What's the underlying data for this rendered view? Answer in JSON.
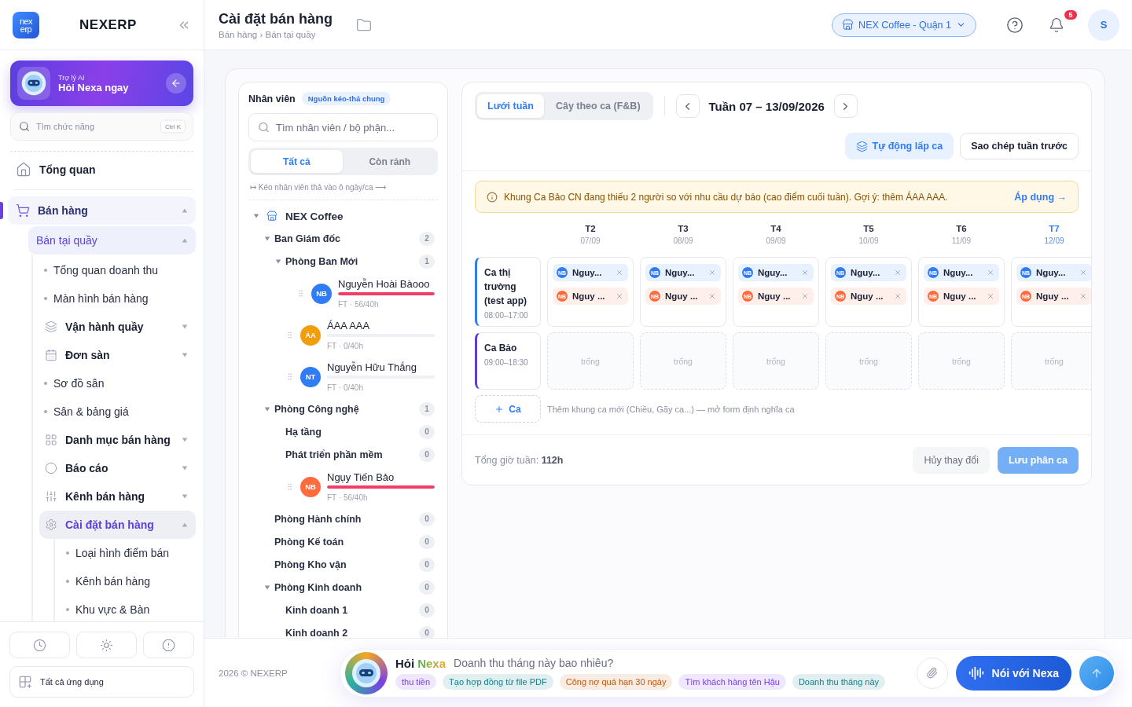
{
  "sidebar": {
    "logo": [
      "nex",
      "erp"
    ],
    "brand": "NEXERP",
    "ai_card": {
      "caption": "Trợ lý AI",
      "title": "Hỏi Nexa ngay"
    },
    "search": {
      "placeholder": "Tìm chức năng",
      "shortcut": "Ctrl K"
    },
    "nav": [
      {
        "label": "Tổng quan",
        "kind": "top",
        "selected": false
      },
      {
        "label": "Bán hàng",
        "kind": "section",
        "selected": true,
        "expanded": true,
        "children": [
          {
            "label": "Bán tại quầy",
            "kind": "sub",
            "selected": true,
            "expanded": true,
            "children": [
              {
                "label": "Tổng quan doanh thu",
                "kind": "leaf",
                "selected": false
              },
              {
                "label": "Màn hình bán hàng",
                "kind": "leaf",
                "selected": false
              },
              {
                "label": "Vận hành quầy",
                "kind": "group",
                "selected": false,
                "expanded": false
              },
              {
                "label": "Đơn sàn",
                "kind": "group",
                "selected": false,
                "expanded": false
              },
              {
                "label": "Sơ đồ sân",
                "kind": "leaf",
                "selected": false
              },
              {
                "label": "Sân & bảng giá",
                "kind": "leaf",
                "selected": false
              },
              {
                "label": "Danh mục bán hàng",
                "kind": "group",
                "selected": false,
                "expanded": false
              },
              {
                "label": "Báo cáo",
                "kind": "group",
                "selected": false,
                "expanded": false
              },
              {
                "label": "Kênh bán hàng",
                "kind": "group",
                "selected": false,
                "expanded": false
              },
              {
                "label": "Cài đặt bán hàng",
                "kind": "group",
                "selected": true,
                "expanded": true,
                "children": [
                  {
                    "label": "Loại hình điểm bán",
                    "kind": "leaf",
                    "selected": false
                  },
                  {
                    "label": "Kênh bán hàng",
                    "kind": "leaf",
                    "selected": false
                  },
                  {
                    "label": "Khu vực & Bàn",
                    "kind": "leaf",
                    "selected": false
                  }
                ]
              }
            ]
          }
        ]
      }
    ],
    "all_apps": "Tất cả ứng dụng"
  },
  "header": {
    "title": "Cài đặt bán hàng",
    "breadcrumb": "Bán hàng › Bán tại quầy",
    "branch": "NEX Coffee - Quận 1",
    "notifications": "5",
    "avatar": "S"
  },
  "staff_panel": {
    "title": "Nhân viên",
    "badge": "Nguồn kéo-thả chung",
    "search": {
      "placeholder": "Tìm nhân viên / bộ phận..."
    },
    "filters": [
      {
        "label": "Tất cả",
        "selected": true
      },
      {
        "label": "Còn rảnh",
        "selected": false
      }
    ],
    "hint": "↦ Kéo nhân viên thả vào ô ngày/ca ⟶",
    "tree": [
      {
        "kind": "org",
        "label": "NEX Coffee",
        "expanded": true,
        "children": [
          {
            "kind": "dept",
            "label": "Ban Giám đốc",
            "count": "2",
            "expanded": true,
            "children": [
              {
                "kind": "dept",
                "label": "Phòng Ban Mới",
                "count": "1",
                "expanded": true,
                "children": [
                  {
                    "kind": "employee",
                    "label": "Nguyễn Hoài Bàooo",
                    "initials": "NB",
                    "color": "#2f7cf6",
                    "meta": "FT · 56/40h",
                    "level": 1
                  }
                ]
              },
              {
                "kind": "employee",
                "label": "ÁAA AAA",
                "initials": "ÁA",
                "color": "#f29d0c",
                "meta": "FT · 0/40h",
                "level": 0
              },
              {
                "kind": "employee",
                "label": "Nguyễn Hữu Thắng",
                "initials": "NT",
                "color": "#2f7cf6",
                "meta": "FT · 0/40h",
                "level": 0
              }
            ]
          },
          {
            "kind": "dept",
            "label": "Phòng Công nghệ",
            "count": "1",
            "expanded": true,
            "children": [
              {
                "kind": "dept",
                "label": "Hạ tầng",
                "count": "0"
              },
              {
                "kind": "dept",
                "label": "Phát triển phần mềm",
                "count": "0"
              },
              {
                "kind": "employee",
                "label": "Ngụy Tiến Bảo",
                "initials": "NB",
                "color": "#ff6b3d",
                "meta": "FT · 56/40h",
                "level": 1
              }
            ]
          },
          {
            "kind": "dept",
            "label": "Phòng Hành chính",
            "count": "0"
          },
          {
            "kind": "dept",
            "label": "Phòng Kế toán",
            "count": "0"
          },
          {
            "kind": "dept",
            "label": "Phòng Kho vận",
            "count": "0"
          },
          {
            "kind": "dept",
            "label": "Phòng Kinh doanh",
            "count": "0",
            "expanded": true,
            "children": [
              {
                "kind": "dept",
                "label": "Kinh doanh 1",
                "count": "0"
              },
              {
                "kind": "dept",
                "label": "Kinh doanh 2",
                "count": "0"
              }
            ]
          }
        ]
      }
    ]
  },
  "schedule": {
    "views": [
      {
        "label": "Lưới tuần",
        "selected": true
      },
      {
        "label": "Cây theo ca (F&B)",
        "selected": false
      }
    ],
    "week": "Tuần 07 – 13/09/2026",
    "tools": [
      {
        "label": "Tự động lấp ca",
        "kind": "accent"
      },
      {
        "label": "Sao chép tuần trước",
        "kind": "outline"
      }
    ],
    "alert": {
      "text": "Khung Ca Bảo CN đang thiếu 2 người so với nhu cầu dự báo (cao điểm cuối tuần). Gợi ý: thêm ÁAA AAA.",
      "action": "Áp dụng →"
    },
    "days": [
      {
        "label": "T2",
        "date": "07/09",
        "selected": false
      },
      {
        "label": "T3",
        "date": "08/09",
        "selected": false
      },
      {
        "label": "T4",
        "date": "09/09",
        "selected": false
      },
      {
        "label": "T5",
        "date": "10/09",
        "selected": false
      },
      {
        "label": "T6",
        "date": "11/09",
        "selected": false
      },
      {
        "label": "T7",
        "date": "12/09",
        "selected": true
      }
    ],
    "shifts": [
      {
        "name": "Ca thị trường (test app)",
        "time": "08:00–17:00",
        "color": "#2f7cf6",
        "cells": [
          {
            "kind": "filled",
            "staff": [
              {
                "initials": "NB",
                "name": "Nguy...",
                "color": "#2f7cf6"
              },
              {
                "initials": "NB",
                "name": "Nguy ...",
                "color": "#ff6b3d"
              }
            ]
          },
          {
            "kind": "filled",
            "staff": [
              {
                "initials": "NB",
                "name": "Nguy...",
                "color": "#2f7cf6"
              },
              {
                "initials": "NB",
                "name": "Nguy ...",
                "color": "#ff6b3d"
              }
            ]
          },
          {
            "kind": "filled",
            "staff": [
              {
                "initials": "NB",
                "name": "Nguy...",
                "color": "#2f7cf6"
              },
              {
                "initials": "NB",
                "name": "Nguy ...",
                "color": "#ff6b3d"
              }
            ]
          },
          {
            "kind": "filled",
            "staff": [
              {
                "initials": "NB",
                "name": "Nguy...",
                "color": "#2f7cf6"
              },
              {
                "initials": "NB",
                "name": "Nguy ...",
                "color": "#ff6b3d"
              }
            ]
          },
          {
            "kind": "filled",
            "staff": [
              {
                "initials": "NB",
                "name": "Nguy...",
                "color": "#2f7cf6"
              },
              {
                "initials": "NB",
                "name": "Nguy ...",
                "color": "#ff6b3d"
              }
            ]
          },
          {
            "kind": "filled",
            "staff": [
              {
                "initials": "NB",
                "name": "Nguy...",
                "color": "#2f7cf6"
              },
              {
                "initials": "NB",
                "name": "Nguy ...",
                "color": "#ff6b3d"
              }
            ]
          }
        ]
      },
      {
        "name": "Ca Bảo",
        "time": "09:00–18:30",
        "color": "#5b3fd9",
        "cells": [
          {
            "kind": "empty",
            "label": "trống"
          },
          {
            "kind": "empty",
            "label": "trống"
          },
          {
            "kind": "empty",
            "label": "trống"
          },
          {
            "kind": "empty",
            "label": "trống"
          },
          {
            "kind": "empty",
            "label": "trống"
          },
          {
            "kind": "empty",
            "label": "trống"
          }
        ]
      }
    ],
    "add_shift": {
      "label": "Ca",
      "hint": "Thêm khung ca mới (Chiều, Gãy ca...) — mở form định nghĩa ca"
    },
    "total": {
      "label": "Tổng giờ tuần:",
      "value": "112h"
    },
    "actions": [
      {
        "label": "Hủy thay đổi",
        "kind": "secondary",
        "disabled": false
      },
      {
        "label": "Lưu phân ca",
        "kind": "primary",
        "disabled": true
      }
    ]
  },
  "footer": {
    "copyright": "2026 © NEXERP",
    "assistant": {
      "greeting": "Hỏi",
      "name": "Nexa",
      "placeholder": "Doanh thu tháng này bao nhiêu?",
      "suggestions": [
        {
          "label": "thu tiền",
          "color": "#7b3fe4"
        },
        {
          "label": "Tạo hợp đồng từ file PDF",
          "color": "#0e7f8c"
        },
        {
          "label": "Công nợ quá hạn 30 ngày",
          "color": "#c2570c"
        },
        {
          "label": "Tìm khách hàng tên Hậu",
          "color": "#7b3fe4"
        },
        {
          "label": "Doanh thu tháng này",
          "color": "#0e7f8c"
        }
      ],
      "voice": "Nói với Nexa"
    }
  }
}
